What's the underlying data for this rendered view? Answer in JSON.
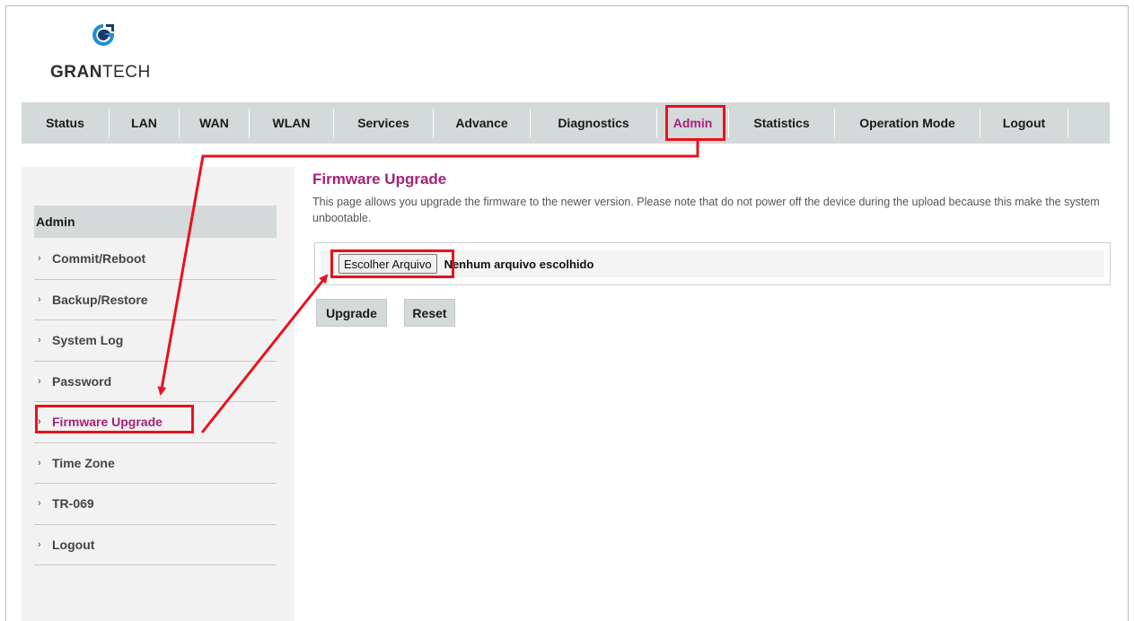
{
  "brand": {
    "name_bold": "GRAN",
    "name_light": "TECH",
    "colors": {
      "mark_blue": "#1e8fd6",
      "mark_navy": "#1d3a6b"
    },
    "icon": "grantech-logo-icon"
  },
  "nav": {
    "items": [
      {
        "label": "Status"
      },
      {
        "label": "LAN"
      },
      {
        "label": "WAN"
      },
      {
        "label": "WLAN"
      },
      {
        "label": "Services"
      },
      {
        "label": "Advance"
      },
      {
        "label": "Diagnostics"
      },
      {
        "label": "Admin",
        "active": true
      },
      {
        "label": "Statistics"
      },
      {
        "label": "Operation Mode"
      },
      {
        "label": "Logout"
      }
    ]
  },
  "sidebar": {
    "header": "Admin",
    "items": [
      {
        "label": "Commit/Reboot"
      },
      {
        "label": "Backup/Restore"
      },
      {
        "label": "System Log"
      },
      {
        "label": "Password"
      },
      {
        "label": "Firmware Upgrade",
        "active": true
      },
      {
        "label": "Time Zone"
      },
      {
        "label": "TR-069"
      },
      {
        "label": "Logout"
      }
    ],
    "chevron_glyph": "›"
  },
  "main": {
    "title": "Firmware Upgrade",
    "description": "This page allows you upgrade the firmware to the newer version. Please note that do not power off the device during the upload because this make the system unbootable.",
    "file_input": {
      "button_label": "Escolher Arquivo",
      "status": "Nenhum arquivo escolhido"
    },
    "buttons": {
      "upgrade": "Upgrade",
      "reset": "Reset"
    }
  },
  "colors": {
    "accent": "#a3237b",
    "nav_bg": "#d4d9d9",
    "sidebar_bg": "#f2f2f2",
    "annotation_red": "#e8121c"
  }
}
